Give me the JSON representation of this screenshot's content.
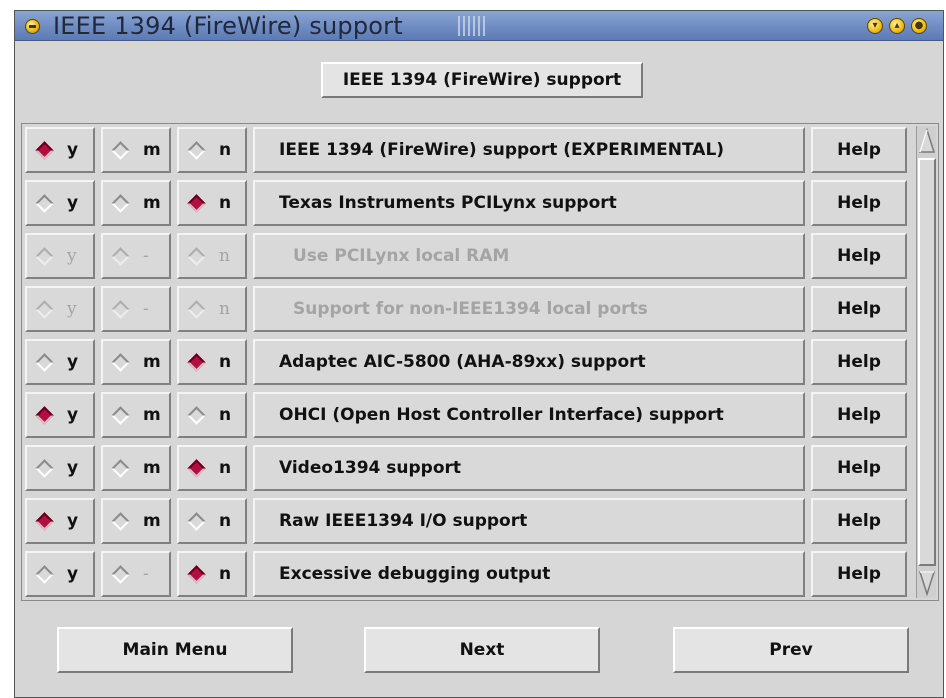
{
  "window": {
    "title": "IEEE 1394 (FireWire) support",
    "controls": [
      "minimize-icon",
      "maximize-icon",
      "close-icon"
    ]
  },
  "header": {
    "label": "IEEE 1394 (FireWire) support"
  },
  "options": [
    {
      "y": "y",
      "m": "m",
      "n": "n",
      "selected": "y",
      "enabled": true,
      "label": "IEEE 1394 (FireWire) support (EXPERIMENTAL)",
      "help": "Help"
    },
    {
      "y": "y",
      "m": "m",
      "n": "n",
      "selected": "n",
      "enabled": true,
      "label": "Texas Instruments PCILynx support",
      "help": "Help"
    },
    {
      "y": "y",
      "m": "-",
      "n": "n",
      "selected": "",
      "enabled": false,
      "label": "Use PCILynx local RAM",
      "help": "Help"
    },
    {
      "y": "y",
      "m": "-",
      "n": "n",
      "selected": "",
      "enabled": false,
      "label": "Support for non-IEEE1394 local ports",
      "help": "Help"
    },
    {
      "y": "y",
      "m": "m",
      "n": "n",
      "selected": "n",
      "enabled": true,
      "label": "Adaptec AIC-5800 (AHA-89xx) support",
      "help": "Help"
    },
    {
      "y": "y",
      "m": "m",
      "n": "n",
      "selected": "y",
      "enabled": true,
      "label": "OHCI (Open Host Controller Interface) support",
      "help": "Help"
    },
    {
      "y": "y",
      "m": "m",
      "n": "n",
      "selected": "n",
      "enabled": true,
      "label": "Video1394 support",
      "help": "Help"
    },
    {
      "y": "y",
      "m": "m",
      "n": "n",
      "selected": "y",
      "enabled": true,
      "label": "Raw IEEE1394 I/O support",
      "help": "Help"
    },
    {
      "y": "y",
      "m": "-",
      "n": "n",
      "selected": "n",
      "enabled": true,
      "label": "Excessive debugging output",
      "help": "Help",
      "m_dim": true
    }
  ],
  "footer": {
    "main_menu": "Main Menu",
    "next": "Next",
    "prev": "Prev"
  },
  "colors": {
    "titlebar": "#6f8cc2",
    "selected_diamond": "#b01040",
    "background": "#d6d6d6"
  }
}
